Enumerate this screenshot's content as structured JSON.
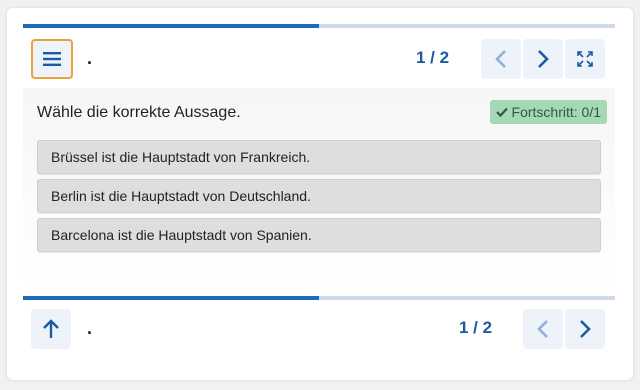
{
  "header": {
    "title": ".",
    "page_counter": "1 / 2",
    "progress_fraction": 0.5
  },
  "question": {
    "prompt": "Wähle die korrekte Aussage.",
    "progress_badge": "Fortschritt: 0/1"
  },
  "options": [
    {
      "label": "Brüssel ist die Hauptstadt von Frankreich."
    },
    {
      "label": "Berlin ist die Hauptstadt von Deutschland."
    },
    {
      "label": "Barcelona ist die Hauptstadt von Spanien."
    }
  ],
  "footer": {
    "title": ".",
    "page_counter": "1 / 2",
    "progress_fraction": 0.5
  },
  "colors": {
    "accent": "#1c6bb8",
    "menu_border": "#e8a33a",
    "badge_bg": "#a4d8b6"
  },
  "icons": [
    "menu-icon",
    "chevron-left-icon",
    "chevron-right-icon",
    "fullscreen-icon",
    "check-icon",
    "arrow-up-icon"
  ]
}
